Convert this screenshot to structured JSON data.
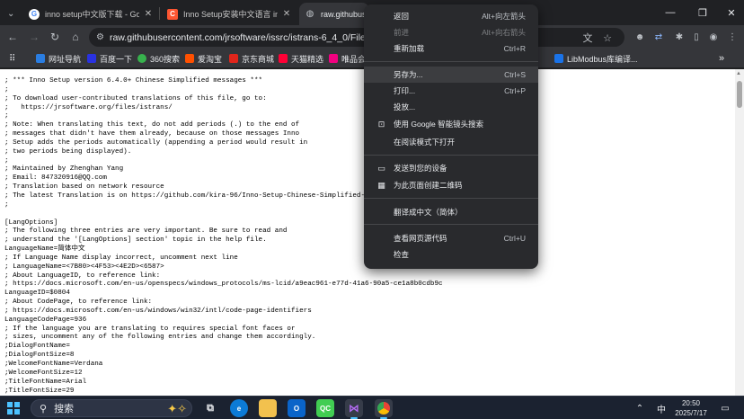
{
  "tabs": [
    {
      "title": "inno setup中文版下载 - Googl",
      "favicon": "google-icon"
    },
    {
      "title": "Inno Setup安装中文语言 inno",
      "favicon": "csdn-icon"
    },
    {
      "title": "raw.githubus",
      "favicon": "globe-icon"
    }
  ],
  "toolbar": {
    "url": "raw.githubusercontent.com/jrsoftware/issrc/istrans-6_4_0/Files/L"
  },
  "bookmarks": [
    {
      "label": "网址导航",
      "color": "#2a7de1"
    },
    {
      "label": "百度一下",
      "color": "#2932e1"
    },
    {
      "label": "360搜索",
      "color": "#37b24d"
    },
    {
      "label": "爱淘宝",
      "color": "#ff5000"
    },
    {
      "label": "京东商城",
      "color": "#e1251b"
    },
    {
      "label": "天猫精选",
      "color": "#ff0036"
    },
    {
      "label": "唯品会",
      "color": "#f10180"
    },
    {
      "label": "LibModbus库编译...",
      "color": "#1a73e8"
    }
  ],
  "content": {
    "text": "; *** Inno Setup version 6.4.0+ Chinese Simplified messages ***\n;\n; To download user-contributed translations of this file, go to:\n;   https://jrsoftware.org/files/istrans/\n;\n; Note: When translating this text, do not add periods (.) to the end of\n; messages that didn't have them already, because on those messages Inno\n; Setup adds the periods automatically (appending a period would result in\n; two periods being displayed).\n;\n; Maintained by Zhenghan Yang\n; Email: 847320916@QQ.com\n; Translation based on network resource\n; The latest Translation is on https://github.com/kira-96/Inno-Setup-Chinese-Simplified-Transla\n;\n\n[LangOptions]\n; The following three entries are very important. Be sure to read and\n; understand the '[LangOptions] section' topic in the help file.\nLanguageName=简体中文\n; If Language Name display incorrect, uncomment next line\n; LanguageName=<7B80><4F53><4E2D><6587>\n; About LanguageID, to reference link:\n; https://docs.microsoft.com/en-us/openspecs/windows_protocols/ms-lcid/a9eac961-e77d-41a6-90a5-ce1a8b0cdb9c\nLanguageID=$0804\n; About CodePage, to reference link:\n; https://docs.microsoft.com/en-us/windows/win32/intl/code-page-identifiers\nLanguageCodePage=936\n; If the language you are translating to requires special font faces or\n; sizes, uncomment any of the following entries and change them accordingly.\n;DialogFontName=\n;DialogFontSize=8\n;WelcomeFontName=Verdana\n;WelcomeFontSize=12\n;TitleFontName=Arial\n;TitleFontSize=29"
  },
  "context_menu": {
    "items": [
      {
        "label": "返回",
        "shortcut": "Alt+向左箭头",
        "icon": "",
        "disabled": false
      },
      {
        "label": "前进",
        "shortcut": "Alt+向右箭头",
        "icon": "",
        "disabled": true
      },
      {
        "label": "重新加载",
        "shortcut": "Ctrl+R",
        "icon": "",
        "disabled": false
      },
      {
        "label": "另存为...",
        "shortcut": "Ctrl+S",
        "icon": "",
        "disabled": false
      },
      {
        "label": "打印...",
        "shortcut": "Ctrl+P",
        "icon": "",
        "disabled": false
      },
      {
        "label": "投放...",
        "shortcut": "",
        "icon": "",
        "disabled": false
      },
      {
        "label": "使用 Google 智能镜头搜索",
        "shortcut": "",
        "icon": "lens-icon",
        "disabled": false
      },
      {
        "label": "在阅读模式下打开",
        "shortcut": "",
        "icon": "",
        "disabled": false
      },
      {
        "label": "发送到您的设备",
        "shortcut": "",
        "icon": "devices-icon",
        "disabled": false
      },
      {
        "label": "为此页面创建二维码",
        "shortcut": "",
        "icon": "qr-code-icon",
        "disabled": false
      },
      {
        "label": "翻译成中文（简体）",
        "shortcut": "",
        "icon": "",
        "disabled": false
      },
      {
        "label": "查看网页源代码",
        "shortcut": "Ctrl+U",
        "icon": "",
        "disabled": false
      },
      {
        "label": "检查",
        "shortcut": "",
        "icon": "",
        "disabled": false
      }
    ]
  },
  "taskbar": {
    "search_label": "搜索",
    "lang": "中",
    "time": "20:50",
    "date": "2025/7/17"
  }
}
